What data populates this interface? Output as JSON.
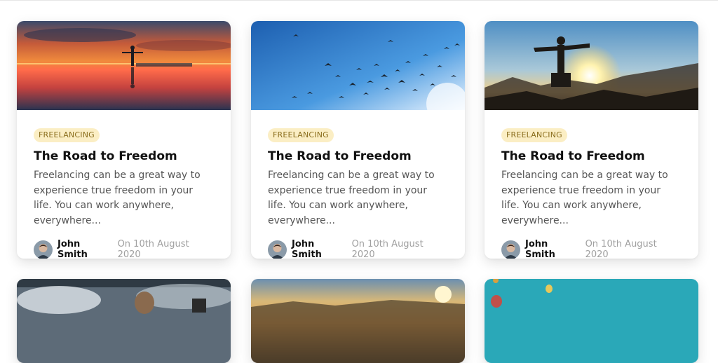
{
  "posts": [
    {
      "tag": "FREELANCING",
      "title": "The Road to Freedom",
      "excerpt": "Freelancing can be a great way to experience true freedom in your life. You can work anywhere, everywhere...",
      "author": "John Smith",
      "date": "On 10th August 2020",
      "image": "sunset-lake-photo"
    },
    {
      "tag": "FREELANCING",
      "title": "The Road to Freedom",
      "excerpt": "Freelancing can be a great way to experience true freedom in your life. You can work anywhere, everywhere...",
      "author": "John Smith",
      "date": "On 10th August 2020",
      "image": "birds-sky-photo"
    },
    {
      "tag": "FREELANCING",
      "title": "The Road to Freedom",
      "excerpt": "Freelancing can be a great way to experience true freedom in your life. You can work anywhere, everywhere...",
      "author": "John Smith",
      "date": "On 10th August 2020",
      "image": "mountain-sunrise-photo"
    }
  ],
  "colors": {
    "tag_bg": "#fbeec4",
    "tag_text": "#8a6d1c",
    "title": "#111111",
    "excerpt": "#555555",
    "date": "#a0a0a0"
  }
}
